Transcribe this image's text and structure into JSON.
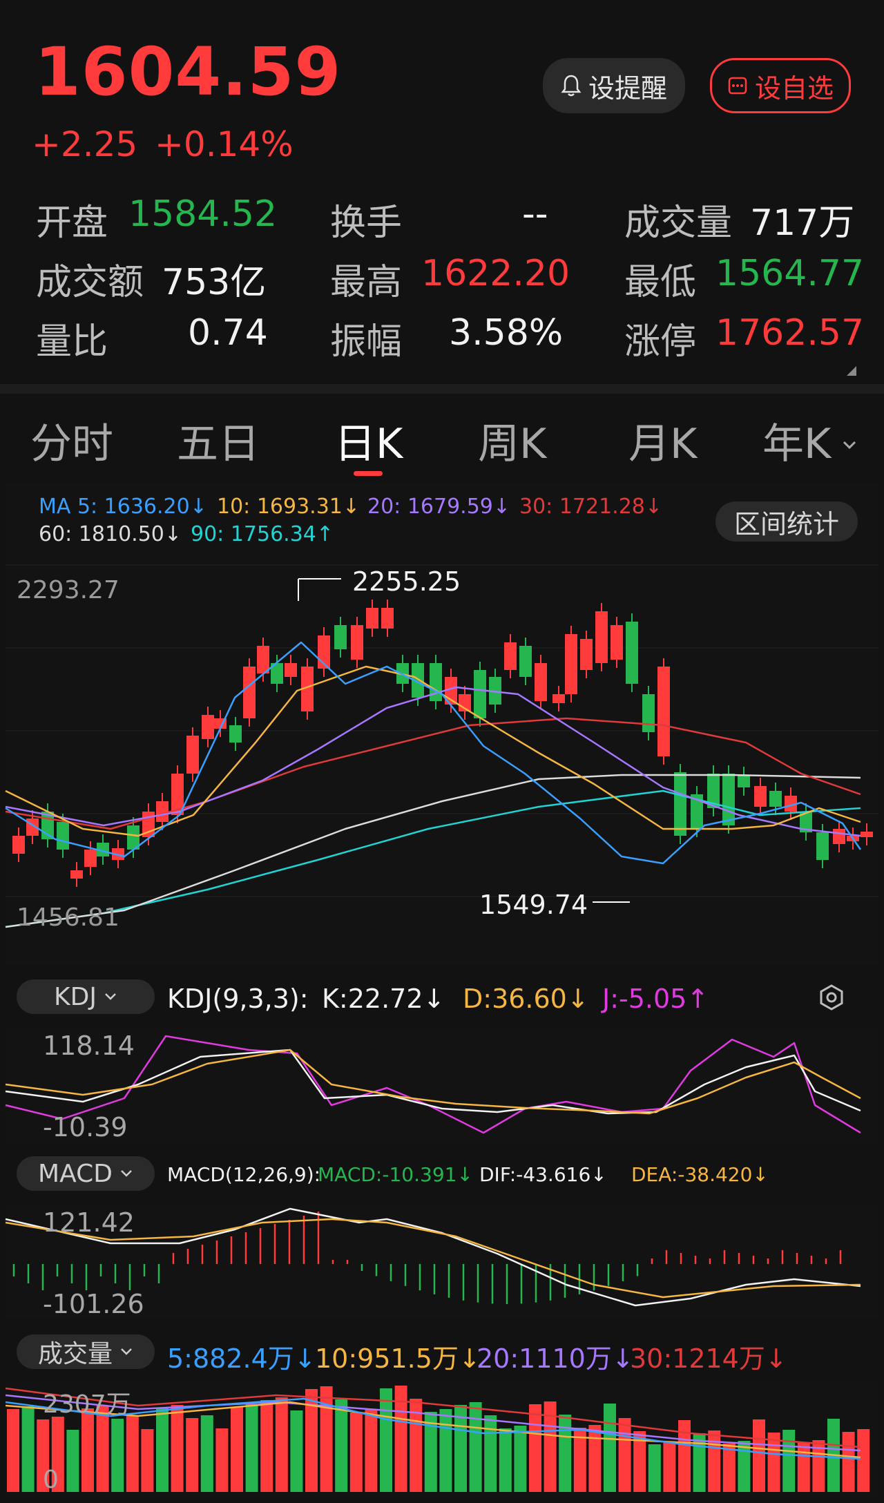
{
  "quote": {
    "price": "1604.59",
    "change": "+2.25",
    "change_pct": "+0.14%",
    "alert_button": "设提醒",
    "watch_button": "设自选",
    "stats": [
      {
        "label": "开盘",
        "value": "1584.52",
        "color": "#26b650"
      },
      {
        "label": "换手",
        "value": "--",
        "color": "#f2f2f2"
      },
      {
        "label": "成交量",
        "value": "717万",
        "color": "#f2f2f2"
      },
      {
        "label": "成交额",
        "value": "753亿",
        "color": "#f2f2f2"
      },
      {
        "label": "最高",
        "value": "1622.20",
        "color": "#ff3b3b"
      },
      {
        "label": "最低",
        "value": "1564.77",
        "color": "#26b650"
      },
      {
        "label": "量比",
        "value": "0.74",
        "color": "#f2f2f2"
      },
      {
        "label": "振幅",
        "value": "3.58%",
        "color": "#f2f2f2"
      },
      {
        "label": "涨停",
        "value": "1762.57",
        "color": "#ff3b3b"
      }
    ]
  },
  "tabs": [
    {
      "label": "分时",
      "active": false
    },
    {
      "label": "五日",
      "active": false
    },
    {
      "label": "日K",
      "active": true
    },
    {
      "label": "周K",
      "active": false
    },
    {
      "label": "月K",
      "active": false
    },
    {
      "label": "年K",
      "active": false
    }
  ],
  "kline": {
    "ma_legend": [
      {
        "text": "MA 5: 1636.20↓",
        "color": "#3aa0ff"
      },
      {
        "text": "10: 1693.31↓",
        "color": "#f5b642"
      },
      {
        "text": "20: 1679.59↓",
        "color": "#a678ff"
      },
      {
        "text": "30: 1721.28↓",
        "color": "#e03a3a"
      },
      {
        "text": "60: 1810.50↓",
        "color": "#dcdcdc"
      },
      {
        "text": "90: 1756.34↑",
        "color": "#22d3d3"
      }
    ],
    "range_button": "区间统计",
    "y_top_label": "2293.27",
    "y_bottom_label": "1456.81",
    "high_marker": "2255.25",
    "low_marker": "1549.74"
  },
  "kdj": {
    "selector": "KDJ",
    "title": "KDJ(9,3,3):",
    "k": "K:22.72↓",
    "d": "D:36.60↓",
    "j": "J:-5.05↑",
    "y_top": "118.14",
    "y_bottom": "-10.39"
  },
  "macd": {
    "selector": "MACD",
    "title": "MACD(12,26,9):",
    "macd": "MACD:-10.391↓",
    "dif": "DIF:-43.616↓",
    "dea": "DEA:-38.420↓",
    "y_top": "121.42",
    "y_bottom": "-101.26"
  },
  "volume": {
    "selector": "成交量",
    "ma5": "5:882.4万↓",
    "ma10": "10:951.5万↓",
    "ma20": "20:1110万↓",
    "ma30": "30:1214万↓",
    "y_top": "2307万",
    "y_bottom": "0"
  },
  "colors": {
    "up": "#ff3b3b",
    "down": "#26b650",
    "background": "#121212"
  },
  "icons": {
    "alert": "bell-icon",
    "watch": "watchlist-icon",
    "settings": "hexagon-settings-icon",
    "dropdown": "chevron-down-icon"
  }
}
